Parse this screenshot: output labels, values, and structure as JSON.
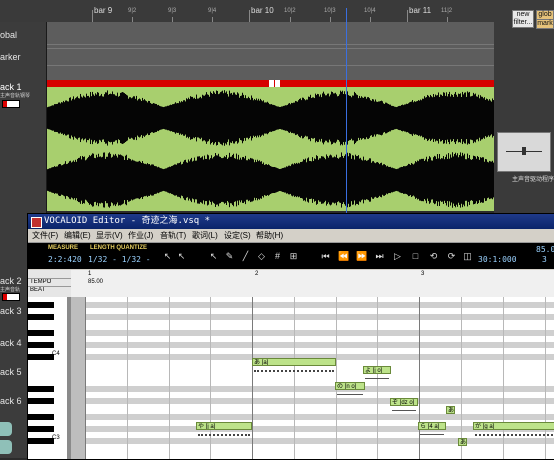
{
  "daw": {
    "ruler": {
      "bars": [
        {
          "label": "bar 9"
        },
        {
          "label": "9|2"
        },
        {
          "label": "9|3"
        },
        {
          "label": "9|4"
        },
        {
          "label": "bar 10"
        },
        {
          "label": "10|2"
        },
        {
          "label": "10|3"
        },
        {
          "label": "10|4"
        },
        {
          "label": "bar 11"
        },
        {
          "label": "11|2"
        }
      ]
    },
    "tracks": {
      "global": "obal",
      "marker": "arker",
      "track1": "ack 1",
      "track1_sub": "主声音轨钢琴",
      "track2": "ack 2",
      "track2_sub": "主声音轨",
      "track3": "ack 3",
      "track4": "ack 4",
      "track5": "ack 5",
      "track6": "ack 6"
    },
    "right_panel": {
      "new_filter": "new filter...",
      "glob": "glob",
      "mark": "mark",
      "plugin_label": "主声音驱动程序"
    }
  },
  "vocaloid": {
    "title": "VOCALOID Editor - 奇迹之海.vsq *",
    "menu": [
      "文件(F)",
      "编辑(E)",
      "显示(V)",
      "作业(J)",
      "音轨(T)",
      "歌词(L)",
      "设定(S)",
      "帮助(H)"
    ],
    "toolbar": {
      "measure_label": "MEASURE",
      "measure_value": "2:2:420",
      "quantize_label": "LENGTH QUANTIZE",
      "quantize_value": "1/32 - 1/32 -",
      "time_value": "30:1:000",
      "tempo_value": "85.0",
      "beat_value": "3"
    },
    "ruler": {
      "tempo_label": "TEMPO",
      "beat_label": "BEAT",
      "tempo_value": "85.00",
      "measures": [
        "1",
        "2",
        "3"
      ]
    },
    "piano": {
      "c4": "C4",
      "c3": "C3"
    },
    "notes": [
      {
        "text": "あ [a]"
      },
      {
        "text": "よ [j o]"
      },
      {
        "text": "の [n o]"
      },
      {
        "text": "ぞ [dz o]"
      },
      {
        "text": "や [j a]"
      },
      {
        "text": "ら [4 a]"
      },
      {
        "text": "あ"
      },
      {
        "text": "が [g a]"
      },
      {
        "text": "あ"
      }
    ]
  }
}
